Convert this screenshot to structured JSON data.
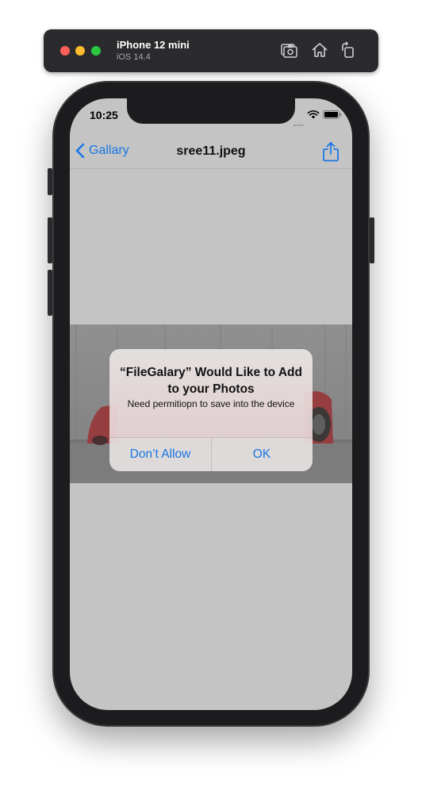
{
  "simulator": {
    "device_name": "iPhone 12 mini",
    "os_version": "iOS 14.4",
    "buttons": {
      "screenshot_icon": "camera-screenshot-icon",
      "home_icon": "home-icon",
      "rotate_icon": "rotate-icon"
    }
  },
  "status_bar": {
    "time": "10:25"
  },
  "nav": {
    "back_label": "Gallary",
    "title": "sree11.jpeg",
    "share_icon": "share-icon"
  },
  "alert": {
    "title": "“FileGalary” Would Like to Add to your Photos",
    "message": "Need permitiopn to save into the device",
    "cancel_label": "Don’t Allow",
    "ok_label": "OK"
  },
  "colors": {
    "accent": "#1976e3",
    "screen_background": "#c4c4c4",
    "car": "#b8262c"
  }
}
